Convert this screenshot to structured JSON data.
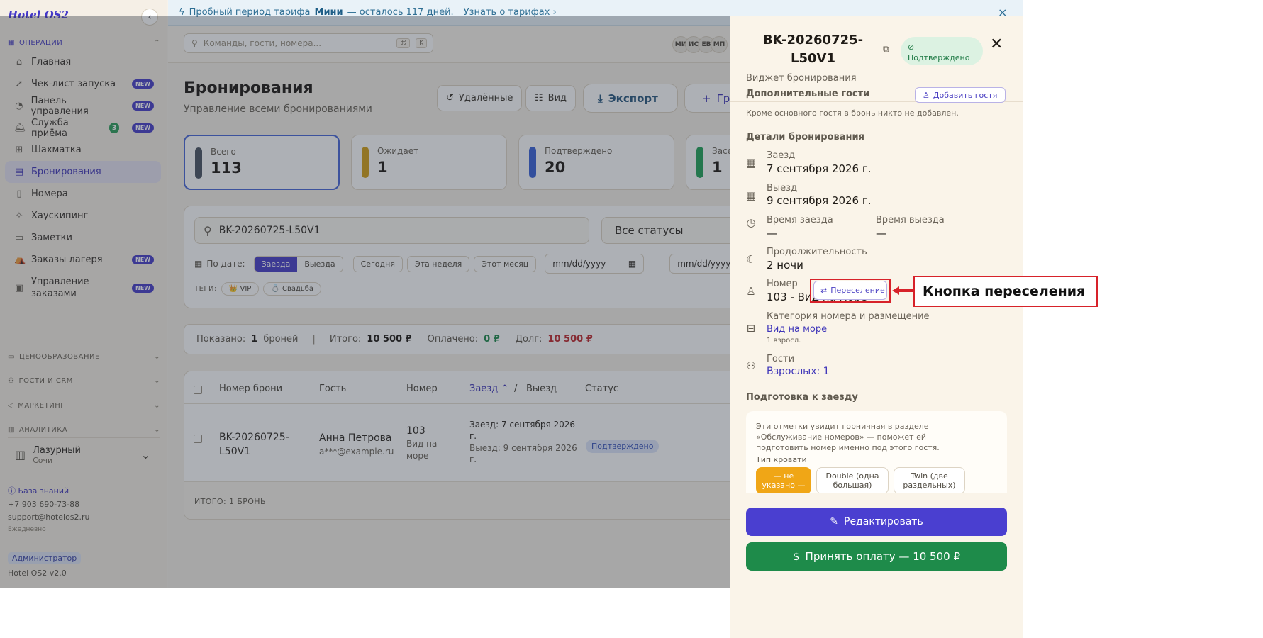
{
  "sidebar": {
    "logo": "Hotel OS2",
    "section_ops": "ОПЕРАЦИИ",
    "items": [
      {
        "label": "Главная",
        "icon": "home-icon"
      },
      {
        "label": "Чек-лист запуска",
        "badge": "NEW",
        "icon": "rocket-icon"
      },
      {
        "label": "Панель управления",
        "badge": "NEW",
        "icon": "gauge-icon"
      },
      {
        "label": "Служба приёма",
        "count": "3",
        "badge": "NEW",
        "icon": "bell-icon"
      },
      {
        "label": "Шахматка",
        "icon": "grid-icon"
      },
      {
        "label": "Бронирования",
        "icon": "clipboard-icon"
      },
      {
        "label": "Номера",
        "icon": "door-icon"
      },
      {
        "label": "Хаускипинг",
        "icon": "sparkle-icon"
      },
      {
        "label": "Заметки",
        "icon": "note-icon"
      },
      {
        "label": "Заказы лагеря",
        "badge": "NEW",
        "icon": "tent-icon"
      },
      {
        "label": "Управление заказами",
        "badge": "NEW",
        "icon": "orders-icon"
      }
    ],
    "sections": [
      "ЦЕНООБРАЗОВАНИЕ",
      "ГОСТИ И CRM",
      "МАРКЕТИНГ",
      "АНАЛИТИКА"
    ],
    "hotel": {
      "name": "Лазурный",
      "city": "Сочи"
    },
    "kb_link": "База знаний",
    "phone": "+7 903 690-73-88",
    "email": "support@hotelos2.ru",
    "schedule": "Ежедневно",
    "role": "Администратор",
    "version": "Hotel OS2 v2.0"
  },
  "trial": {
    "prefix": "Пробный период тарифа",
    "plan": "Мини",
    "suffix": "— осталось 117 дней.",
    "link": "Узнать о тарифах ›",
    "close": "×"
  },
  "topbar": {
    "search_placeholder": "Команды, гости, номера...",
    "kbd1": "⌘",
    "kbd2": "K",
    "avatars": [
      "МИ",
      "ИС",
      "ЕВ",
      "МП"
    ]
  },
  "page": {
    "title": "Бронирования",
    "subtitle": "Управление всеми бронированиями",
    "btn_deleted": "Удалённые",
    "btn_view": "Вид",
    "btn_export": "Экспорт",
    "btn_create": "Гр"
  },
  "stats": [
    {
      "label": "Всего",
      "value": "113",
      "color": "#4b5563"
    },
    {
      "label": "Ожидает",
      "value": "1",
      "color": "#d4a017"
    },
    {
      "label": "Подтверждено",
      "value": "20",
      "color": "#3b63d8"
    },
    {
      "label": "Засе",
      "value": "1",
      "color": "#22a35a"
    }
  ],
  "filters": {
    "search_value": "BK-20260725-L50V1",
    "status": "Все статусы",
    "by_date": "По дате:",
    "seg": [
      "Заезда",
      "Выезда"
    ],
    "chips": [
      "Сегодня",
      "Эта неделя",
      "Этот месяц"
    ],
    "date_placeholder": "mm/dd/yyyy",
    "date_placeholder_2": "mm/dd/yyyy",
    "dash": "—",
    "tags_label": "ТЕГИ:",
    "tags": [
      "👑 VIP",
      "💍 Свадьба"
    ]
  },
  "summary": {
    "shown_label": "Показано:",
    "shown_value": "1",
    "shown_unit": "броней",
    "total_label": "Итого:",
    "total_value": "10 500 ₽",
    "paid_label": "Оплачено:",
    "paid_value": "0 ₽",
    "debt_label": "Долг:",
    "debt_value": "10 500 ₽",
    "separator": "|"
  },
  "table": {
    "headers": {
      "number": "Номер брони",
      "guest": "Гость",
      "room": "Номер",
      "checkin": "Заезд ⌃",
      "slash": "/",
      "checkout": "Выезд",
      "status": "Статус"
    },
    "row": {
      "number_1": "BK-20260725-",
      "number_2": "L50V1",
      "guest": "Анна Петрова",
      "email": "a***@example.ru",
      "room": "103",
      "room_type_1": "Вид на",
      "room_type_2": "море",
      "checkin_1": "Заезд: 7 сентября 2026",
      "checkin_2": "г.",
      "checkout_1": "Выезд: 9 сентября 2026",
      "checkout_2": "г.",
      "status": "Подтверждено"
    },
    "footer": "ИТОГО: 1 БРОНЬ"
  },
  "drawer": {
    "title": "BK-20260725-L50V1",
    "status": "Подтверждено",
    "subtitle": "Виджет бронирования",
    "extra_guests_h": "Дополнительные гости",
    "add_guest": "Добавить гостя",
    "extra_guests_note": "Кроме основного гостя в бронь никто не добавлен.",
    "details_h": "Детали бронирования",
    "checkin_lbl": "Заезд",
    "checkin_val": "7 сентября 2026 г.",
    "checkout_lbl": "Выезд",
    "checkout_val": "9 сентября 2026 г.",
    "checkin_time_lbl": "Время заезда",
    "checkin_time_val": "—",
    "checkout_time_lbl": "Время выезда",
    "checkout_time_val": "—",
    "duration_lbl": "Продолжительность",
    "duration_val": "2 ночи",
    "room_lbl": "Номер",
    "room_val": "103 - Вид на море",
    "resettle_btn": "Переселение",
    "category_lbl": "Категория номера и размещение",
    "category_val": "Вид на море",
    "category_note": "1 взросл.",
    "guests_lbl": "Гости",
    "guests_val": "Взрослых: 1",
    "prep_h": "Подготовка к заезду",
    "prep_text": "Эти отметки увидит горничная в разделе «Обслуживание номеров» — поможет ей подготовить номер именно под этого гостя.",
    "bed_lbl": "Тип кровати",
    "bed_opts": [
      "— не указано —",
      "Double (одна большая)",
      "Twin (две раздельных)"
    ],
    "btn_edit": "Редактировать",
    "btn_pay": "Принять оплату — 10 500 ₽"
  },
  "annotation": {
    "label": "Кнопка переселения",
    "color": "#d7222a"
  }
}
